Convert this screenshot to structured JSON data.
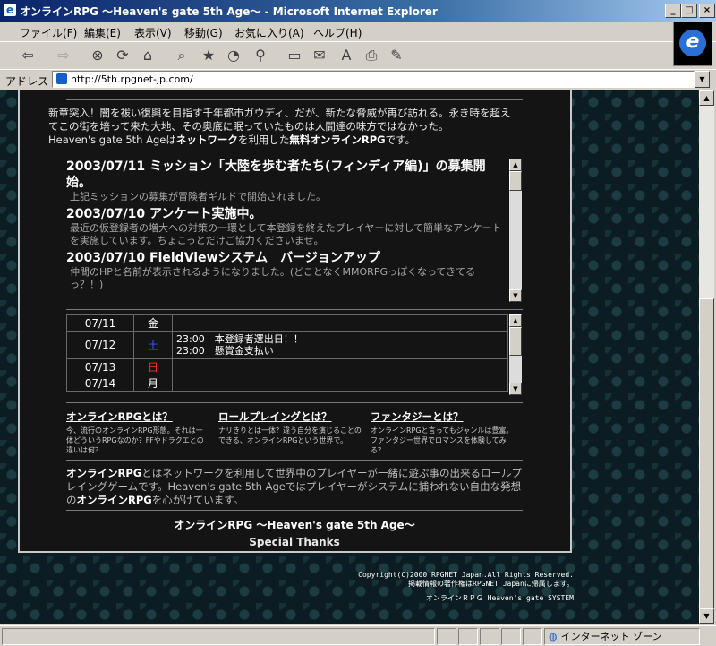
{
  "window": {
    "title": "オンラインRPG ～Heaven's gate 5th Age～ - Microsoft Internet Explorer",
    "min": "_",
    "max": "□",
    "close": "×"
  },
  "menu": [
    "ファイル(F)",
    "編集(E)",
    "表示(V)",
    "移動(G)",
    "お気に入り(A)",
    "ヘルプ(H)"
  ],
  "address": {
    "label": "アドレス",
    "url": "http://5th.rpgnet-jp.com/"
  },
  "intro": {
    "p1": "新章突入！闇を祓い復興を目指す千年都市ガウディ、だが、新たな脅威が再び訪れる。永き時を超えてこの街を培って来た大地、その奥底に眠っていたものは人間達の味方ではなかった。",
    "p2a": "Heaven's gate 5th Ageは",
    "p2b": "ネットワーク",
    "p2c": "を利用した",
    "p2d": "無料オンラインRPG",
    "p2e": "です。"
  },
  "news": [
    {
      "head": "2003/07/11 ミッション「大陸を歩む者たち(フィンディア編)」の募集開始。",
      "body": "上記ミッションの募集が冒険者ギルドで開始されました。"
    },
    {
      "head": "2003/07/10 アンケート実施中。",
      "body": "最近の仮登録者の増大への対策の一環として本登録を終えたプレイヤーに対して簡単なアンケートを実施しています。ちょこっとだけご協力くださいませ。"
    },
    {
      "head": "2003/07/10 FieldViewシステム　バージョンアップ",
      "body": "仲間のHPと名前が表示されるようになりました。(どことなくMMORPGっぽくなってきてるっ？！)"
    }
  ],
  "calendar": [
    {
      "date": "07/11",
      "dow": "金",
      "color": "#ffffff",
      "events": ""
    },
    {
      "date": "07/12",
      "dow": "土",
      "color": "#3a5cff",
      "events": "23:00　本登録者選出日！！\n23:00　懸賞金支払い"
    },
    {
      "date": "07/13",
      "dow": "日",
      "color": "#ff2a2a",
      "events": ""
    },
    {
      "date": "07/14",
      "dow": "月",
      "color": "#ffffff",
      "events": ""
    }
  ],
  "columns": [
    {
      "title": "オンラインRPGとは？",
      "body": "今、流行のオンラインRPG形態。それは一体どういうRPGなのか？FFやドラクエとの違いは何？"
    },
    {
      "title": "ロールプレイングとは？",
      "body": "ナリきりとは一体？違う自分を演じることのできる、オンラインRPGという世界で。"
    },
    {
      "title": "ファンタジーとは？",
      "body": "オンラインRPGと言ってもジャンルは豊富。ファンタジー世界でロマンスを体験してみる？"
    }
  ],
  "desc": {
    "a": "オンラインRPG",
    "b": "とはネットワークを利用して世界中のプレイヤーが一緒に遊ぶ事の出来るロールプレイングゲームです。Heaven's gate 5th Ageではプレイヤーがシステムに捕われない自由な発想の",
    "c": "オンラインRPG",
    "d": "を心がけています。"
  },
  "footer": {
    "title": "オンラインRPG ～Heaven's gate 5th Age～",
    "link": "Special Thanks"
  },
  "copyright": {
    "line1": "Copyright(C)2000 RPGNET Japan.All Rights Reserved.",
    "line2": "掲載情報の著作権はRPGNET Japanに帰属します。",
    "system": "オンラインＲＰＧ Heaven's gate SYSTEM"
  },
  "status": {
    "zone": "インターネット ゾーン"
  }
}
